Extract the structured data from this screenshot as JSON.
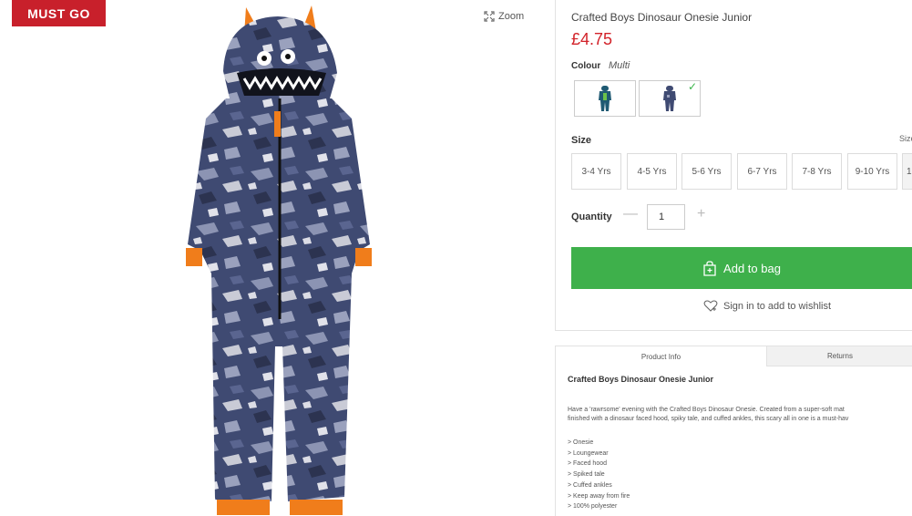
{
  "badge": {
    "label": "MUST GO"
  },
  "zoom": {
    "label": "Zoom",
    "icon": "expand-icon"
  },
  "product": {
    "title": "Crafted Boys Dinosaur Onesie Junior",
    "price": "£4.75",
    "image_icon": "onesie-image"
  },
  "colour": {
    "label": "Colour",
    "value": "Multi",
    "swatches": [
      {
        "name": "green-blue",
        "selected": false
      },
      {
        "name": "camo-blue",
        "selected": true
      }
    ]
  },
  "size": {
    "label": "Size",
    "guide_label": "Size",
    "options": [
      "3-4 Yrs",
      "4-5 Yrs",
      "5-6 Yrs",
      "6-7 Yrs",
      "7-8 Yrs",
      "9-10 Yrs",
      "1"
    ]
  },
  "quantity": {
    "label": "Quantity",
    "value": "1",
    "minus": "—",
    "plus": "+"
  },
  "cart": {
    "add_label": "Add to bag",
    "icon": "bag-icon"
  },
  "wishlist": {
    "label": "Sign in to add to wishlist",
    "icon": "heart-icon"
  },
  "info": {
    "tabs": [
      "Product Info",
      "Returns"
    ],
    "title": "Crafted Boys Dinosaur Onesie Junior",
    "desc_line1": "Have a 'rawrsome' evening with the Crafted Boys Dinosaur Onesie. Created from a super-soft mat",
    "desc_line2": "finished with a dinosaur faced hood, spiky tale, and cuffed ankles, this scary all in one is a must-hav",
    "features": [
      "> Onesie",
      "> Loungewear",
      "> Faced hood",
      "> Spiked tale",
      "> Cuffed ankles",
      "> Keep away from fire",
      "> 100% polyester"
    ]
  },
  "colors": {
    "accent_green": "#3eb04b",
    "price_red": "#d2232a",
    "badge_red": "#c8202b"
  }
}
